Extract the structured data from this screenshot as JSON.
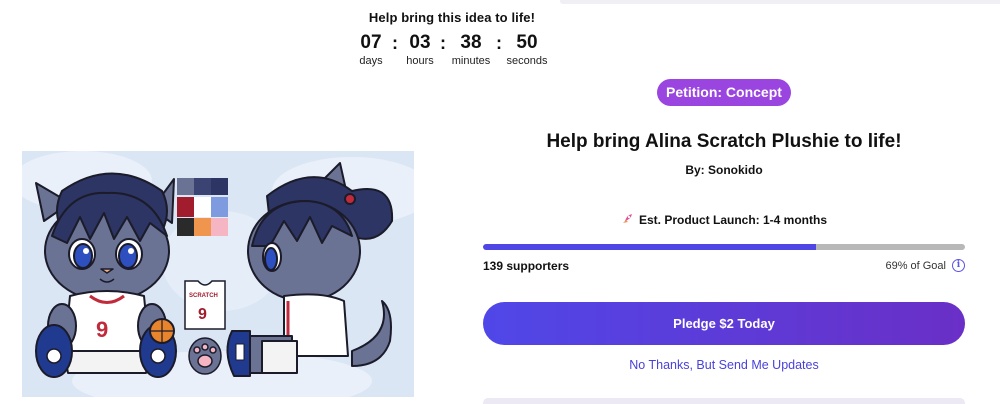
{
  "countdown": {
    "title": "Help bring this idea to life!",
    "units": [
      {
        "value": "07",
        "label": "days"
      },
      {
        "value": "03",
        "label": "hours"
      },
      {
        "value": "38",
        "label": "minutes"
      },
      {
        "value": "50",
        "label": "seconds"
      }
    ],
    "separator": ":"
  },
  "product_image": {
    "shirt_text": "SCRATCH",
    "shirt_number": "9"
  },
  "campaign": {
    "badge": "Petition: Concept",
    "title": "Help bring Alina Scratch Plushie to life!",
    "byline": "By: Sonokido",
    "launch_icon": "rocket-icon",
    "launch_text": "Est. Product Launch: 1-4 months",
    "progress_percent": 69,
    "supporters": "139 supporters",
    "goal_text": "69% of Goal",
    "pledge_label": "Pledge $2 Today",
    "updates_label": "No Thanks, But Send Me Updates"
  },
  "colors": {
    "badge": "#9a45df",
    "progress_fill": "#4f46e5",
    "progress_track": "#b8b8b8",
    "pledge_start": "#5047e8",
    "pledge_end": "#6a2fc7",
    "link": "#4a42d8"
  }
}
